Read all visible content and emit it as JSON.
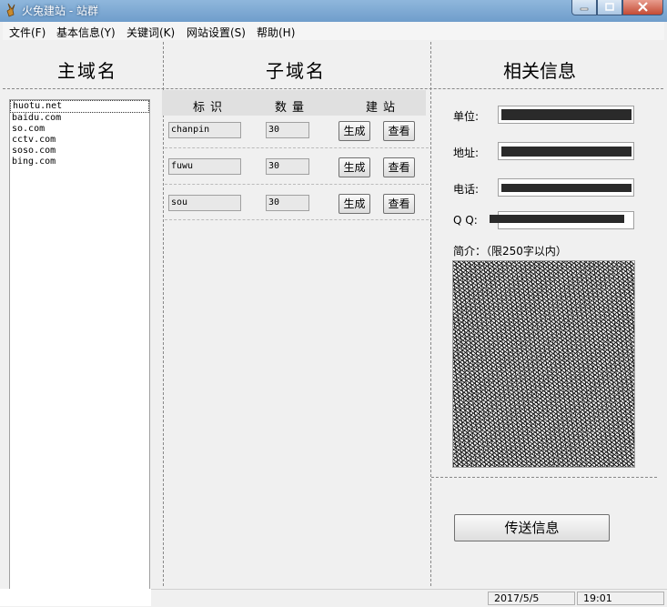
{
  "window": {
    "title": "火兔建站 - 站群"
  },
  "menu": [
    {
      "label": "文件(F)"
    },
    {
      "label": "基本信息(Y)"
    },
    {
      "label": "关键词(K)"
    },
    {
      "label": "网站设置(S)"
    },
    {
      "label": "帮助(H)"
    }
  ],
  "main_domain": {
    "header": "主域名",
    "items": [
      "huotu.net",
      "baidu.com",
      "so.com",
      "cctv.com",
      "soso.com",
      "bing.com"
    ]
  },
  "sub_domain": {
    "header": "子域名",
    "col_id": "标识",
    "col_count": "数量",
    "col_build": "建站",
    "rows": [
      {
        "id": "chanpin",
        "count": "30",
        "generate": "生成",
        "view": "查看"
      },
      {
        "id": "fuwu",
        "count": "30",
        "generate": "生成",
        "view": "查看"
      },
      {
        "id": "sou",
        "count": "30",
        "generate": "生成",
        "view": "查看"
      }
    ]
  },
  "info": {
    "header": "相关信息",
    "unit_label": "单位:",
    "address_label": "地址:",
    "phone_label": "电话:",
    "qq_label": "Q Q:",
    "intro_label": "简介：（限250字以内）",
    "send_label": "传送信息"
  },
  "status": {
    "date": "2017/5/5",
    "time": "19:01"
  }
}
